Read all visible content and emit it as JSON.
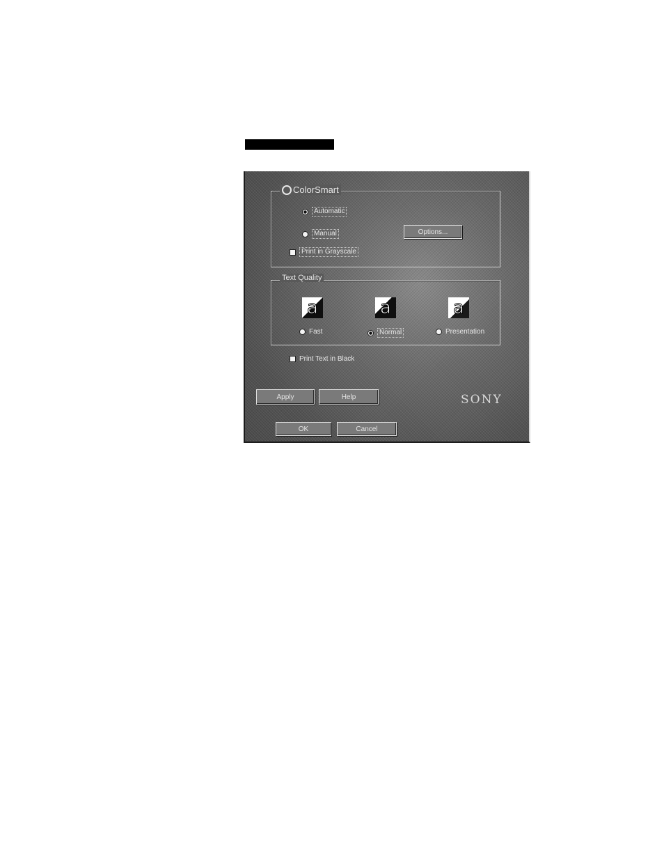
{
  "dialog": {
    "colorsmart": {
      "title": "ColorSmart",
      "radio1": "Automatic",
      "radio2": "Manual",
      "options_button": "Options...",
      "checkbox": "Print in Grayscale"
    },
    "text_quality": {
      "title": "Text Quality",
      "options": [
        "Fast",
        "Normal",
        "Presentation"
      ],
      "selected": "Normal"
    },
    "bottom_checkbox": "Print Text in Black",
    "buttons": {
      "apply": "Apply",
      "help": "Help"
    },
    "brand": "SONY",
    "footer": {
      "ok": "OK",
      "cancel": "Cancel"
    }
  }
}
